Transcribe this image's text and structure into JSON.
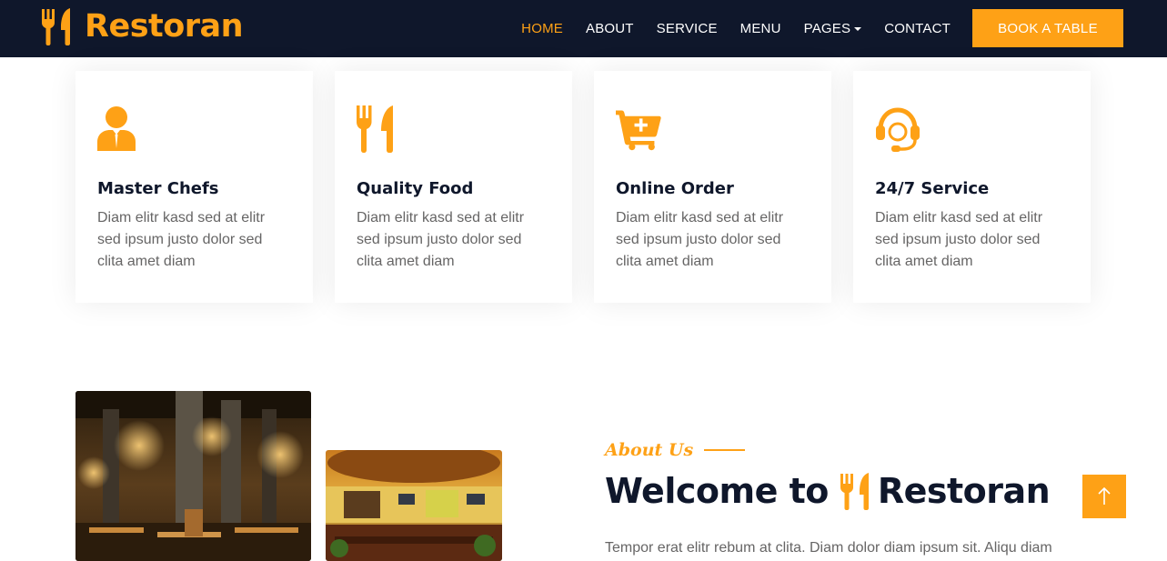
{
  "brand": {
    "name": "Restoran",
    "icon": "utensils-icon"
  },
  "nav": {
    "items": [
      {
        "label": "HOME",
        "active": true
      },
      {
        "label": "ABOUT",
        "active": false
      },
      {
        "label": "SERVICE",
        "active": false
      },
      {
        "label": "MENU",
        "active": false
      },
      {
        "label": "PAGES",
        "active": false,
        "dropdown": true
      },
      {
        "label": "CONTACT",
        "active": false
      }
    ],
    "cta_label": "BOOK A TABLE"
  },
  "services": [
    {
      "icon": "chef-icon",
      "title": "Master Chefs",
      "text": "Diam elitr kasd sed at elitr sed ipsum justo dolor sed clita amet diam"
    },
    {
      "icon": "utensils-icon",
      "title": "Quality Food",
      "text": "Diam elitr kasd sed at elitr sed ipsum justo dolor sed clita amet diam"
    },
    {
      "icon": "cart-plus-icon",
      "title": "Online Order",
      "text": "Diam elitr kasd sed at elitr sed ipsum justo dolor sed clita amet diam"
    },
    {
      "icon": "headset-icon",
      "title": "24/7 Service",
      "text": "Diam elitr kasd sed at elitr sed ipsum justo dolor sed clita amet diam"
    }
  ],
  "about": {
    "label": "About Us",
    "heading_prefix": "Welcome to",
    "heading_brand": "Restoran",
    "text": "Tempor erat elitr rebum at clita. Diam dolor diam ipsum sit. Aliqu diam"
  },
  "colors": {
    "primary": "#fea116",
    "dark": "#0f172b",
    "body_text": "#666565"
  },
  "back_to_top": {
    "icon": "arrow-up-icon"
  }
}
